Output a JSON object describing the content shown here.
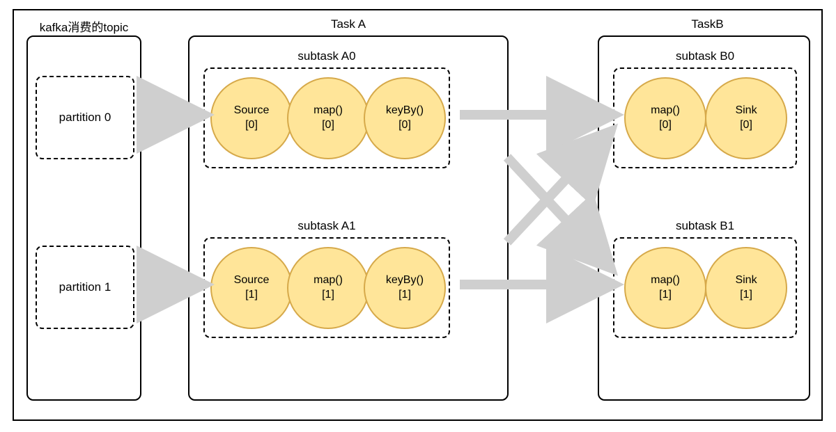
{
  "titles": {
    "kafka": "kafka消费的topic",
    "taskA": "Task A",
    "taskB": "TaskB"
  },
  "partitions": {
    "p0": "partition 0",
    "p1": "partition 1"
  },
  "subtasks": {
    "a0": "subtask A0",
    "a1": "subtask A1",
    "b0": "subtask B0",
    "b1": "subtask B1"
  },
  "ops": {
    "a0": {
      "o1": "Source",
      "o1i": "[0]",
      "o2": "map()",
      "o2i": "[0]",
      "o3": "keyBy()",
      "o3i": "[0]"
    },
    "a1": {
      "o1": "Source",
      "o1i": "[1]",
      "o2": "map()",
      "o2i": "[1]",
      "o3": "keyBy()",
      "o3i": "[1]"
    },
    "b0": {
      "o1": "map()",
      "o1i": "[0]",
      "o2": "Sink",
      "o2i": "[0]"
    },
    "b1": {
      "o1": "map()",
      "o1i": "[1]",
      "o2": "Sink",
      "o2i": "[1]"
    }
  }
}
